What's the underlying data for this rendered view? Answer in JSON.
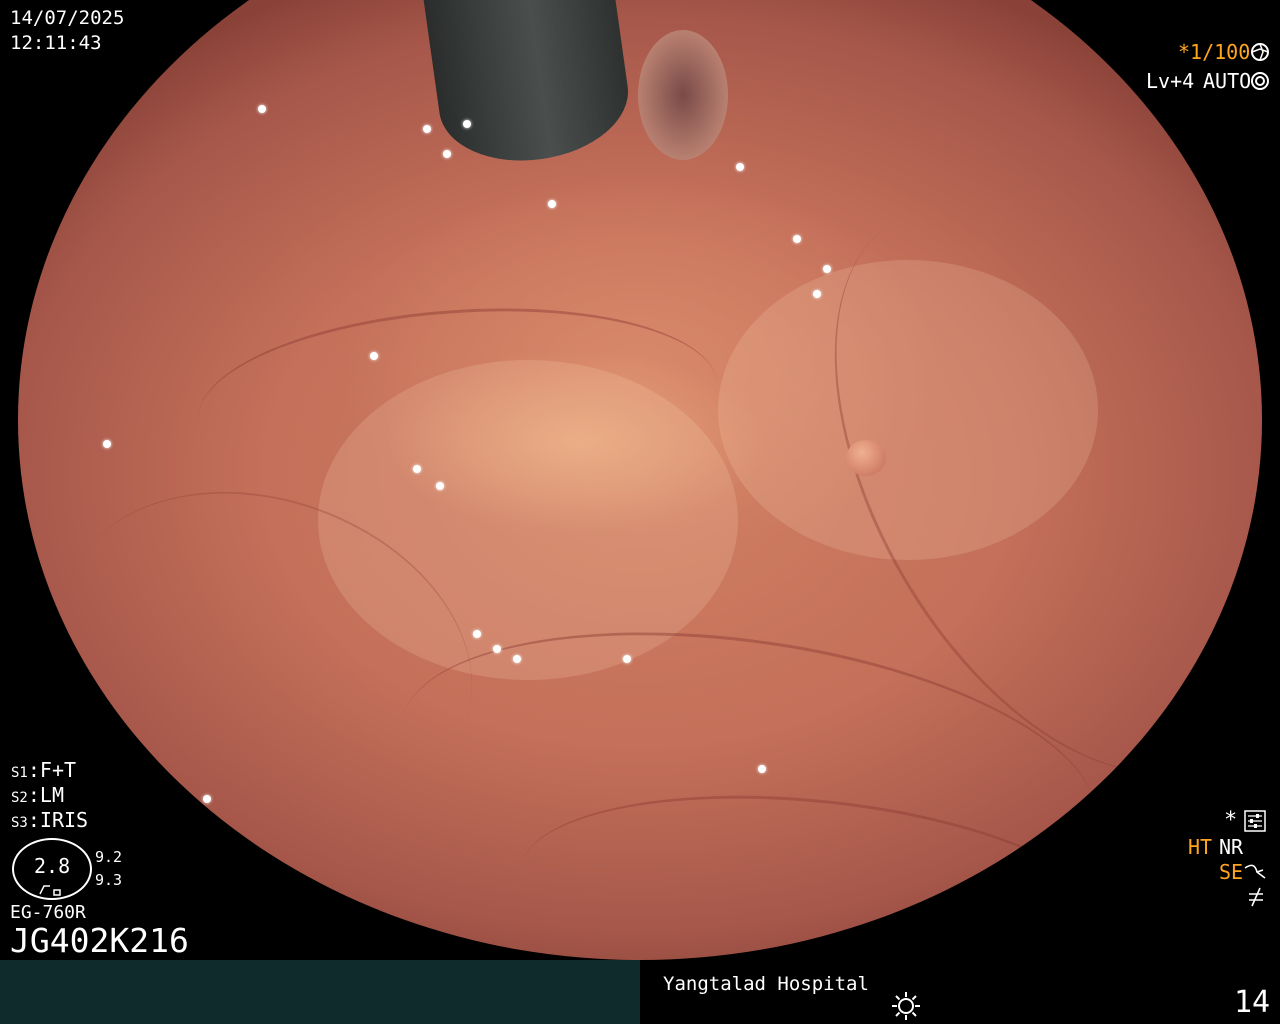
{
  "osd": {
    "date": "14/07/2025",
    "time": "12:11:43",
    "shutter": "*1/100",
    "shutter_icon": "aperture-icon",
    "level": "Lv+4",
    "exposure_mode": "AUTO",
    "exposure_icon": "iris-icon",
    "s1": {
      "key": "S1",
      "value": "F+T"
    },
    "s2": {
      "key": "S2",
      "value": "LM"
    },
    "s3": {
      "key": "S3",
      "value": "IRIS"
    },
    "zoom": "2.8",
    "zoom_side_top": "9.2",
    "zoom_side_bottom": "9.3",
    "scope_model": "EG-760R",
    "scope_serial": "JG402K216",
    "star": "*",
    "ht": "HT",
    "nr": "NR",
    "se": "SE",
    "hospital": "Yangtalad Hospital",
    "image_number": "14"
  },
  "colors": {
    "osd_text": "#ffffff",
    "osd_accent": "#ffa520",
    "bottom_bar": "#0f2b2b",
    "background": "#000000"
  },
  "icons": {
    "settings": "settings-sliders-icon",
    "se": "se-curve-icon",
    "freeze": "not-equal-icon",
    "light": "sun-icon"
  }
}
